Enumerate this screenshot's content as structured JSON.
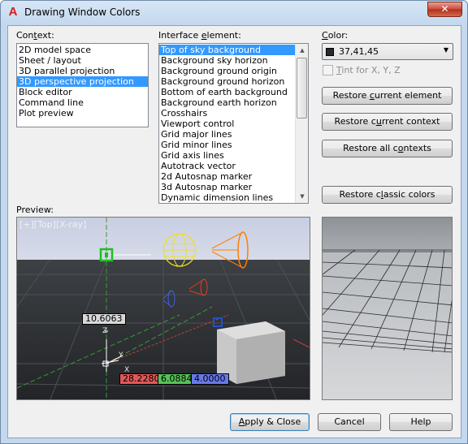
{
  "window": {
    "title": "Drawing Window Colors",
    "close_glyph": "✕",
    "app_icon": "A"
  },
  "context": {
    "label_pre": "Con",
    "label_u": "t",
    "label_post": "ext:",
    "items": [
      "2D model space",
      "Sheet / layout",
      "3D parallel projection",
      "3D perspective projection",
      "Block editor",
      "Command line",
      "Plot preview"
    ],
    "selected_index": 3
  },
  "interface": {
    "label_pre": "Interface ",
    "label_u": "e",
    "label_post": "lement:",
    "items": [
      "Top of sky background",
      "Background sky horizon",
      "Background ground origin",
      "Background ground horizon",
      "Bottom of earth background",
      "Background earth horizon",
      "Crosshairs",
      "Viewport control",
      "Grid major lines",
      "Grid minor lines",
      "Grid axis lines",
      "Autotrack vector",
      "2d Autosnap marker",
      "3d Autosnap marker",
      "Dynamic dimension lines"
    ],
    "selected_index": 0
  },
  "color": {
    "label_pre": "",
    "label_u": "C",
    "label_post": "olor:",
    "value": "37,41,45",
    "swatch": "#252930",
    "tint_pre": "",
    "tint_u": "T",
    "tint_post": "int for X, Y, Z"
  },
  "buttons": {
    "restore_element_pre": "Restore ",
    "restore_element_u": "c",
    "restore_element_post": "urrent element",
    "restore_context_pre": "Restore c",
    "restore_context_u": "u",
    "restore_context_post": "rrent context",
    "restore_all_pre": "Restore all c",
    "restore_all_u": "o",
    "restore_all_post": "ntexts",
    "restore_classic_pre": "Restore c",
    "restore_classic_u": "l",
    "restore_classic_post": "assic colors",
    "apply_pre": "",
    "apply_u": "A",
    "apply_post": "pply & Close",
    "cancel": "Cancel",
    "help": "Help"
  },
  "preview": {
    "label": "Preview:",
    "viewport_label": "[+][Top][X-ray]",
    "dim_value": "10.6063",
    "coord_x": "28.2280",
    "coord_y": "6.0884",
    "coord_z": "4.0000",
    "axis_z": "Z",
    "axis_y": "Y",
    "axis_x": "X"
  }
}
